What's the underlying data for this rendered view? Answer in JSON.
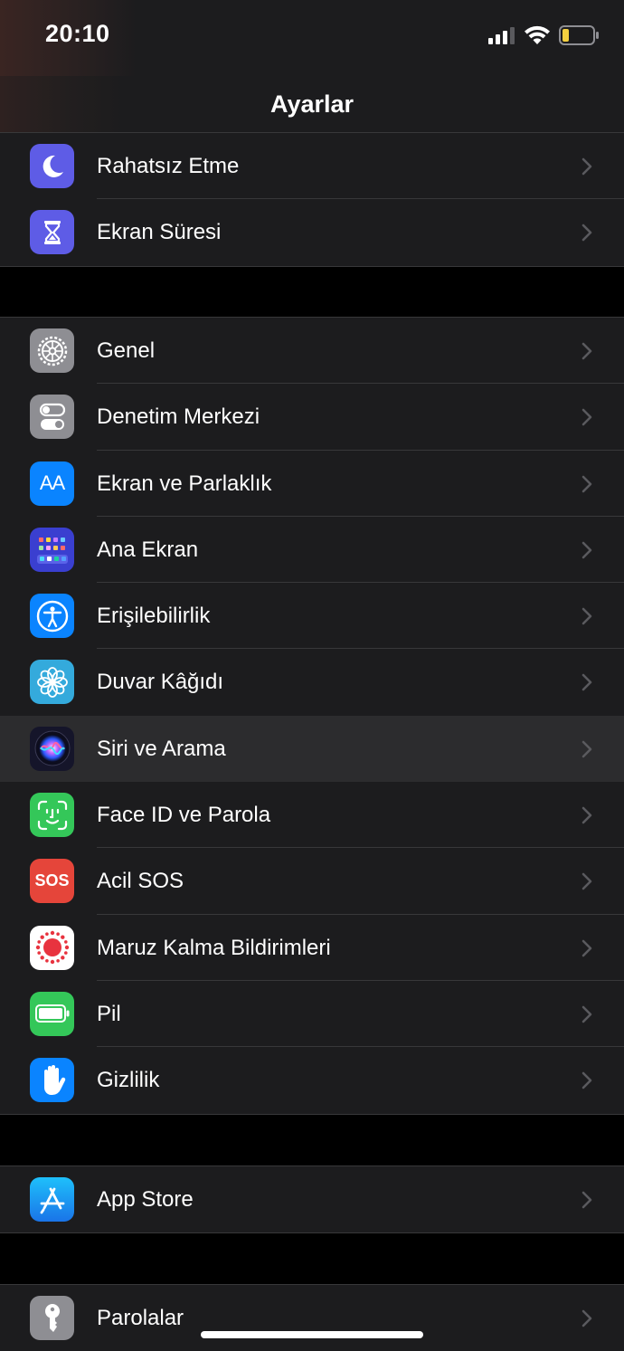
{
  "status_bar": {
    "time": "20:10",
    "icons": [
      "cellular-signal-icon",
      "wifi-icon",
      "battery-low-icon"
    ],
    "battery_color": "#f4d03f"
  },
  "navbar": {
    "title": "Ayarlar"
  },
  "groups": [
    {
      "items": [
        {
          "label": "Rahatsız Etme",
          "icon": "moon-icon",
          "color": "#5e5ce6"
        },
        {
          "label": "Ekran Süresi",
          "icon": "hourglass-icon",
          "color": "#5e5ce6"
        }
      ]
    },
    {
      "items": [
        {
          "label": "Genel",
          "icon": "gear-icon",
          "color": "#8e8e93"
        },
        {
          "label": "Denetim Merkezi",
          "icon": "toggles-icon",
          "color": "#8e8e93"
        },
        {
          "label": "Ekran ve Parlaklık",
          "icon": "text-size-icon",
          "icon_text": "AA",
          "color": "#0a84ff"
        },
        {
          "label": "Ana Ekran",
          "icon": "home-screen-grid-icon",
          "color": "#3a3fd0"
        },
        {
          "label": "Erişilebilirlik",
          "icon": "accessibility-icon",
          "color": "#0a84ff"
        },
        {
          "label": "Duvar Kâğıdı",
          "icon": "flower-icon",
          "color": "#34aadc"
        },
        {
          "label": "Siri ve Arama",
          "icon": "siri-icon",
          "color": "#1a1a2e",
          "highlighted": true
        },
        {
          "label": "Face ID ve Parola",
          "icon": "face-id-icon",
          "color": "#34c759"
        },
        {
          "label": "Acil SOS",
          "icon": "sos-icon",
          "icon_text": "SOS",
          "color": "#e5453a"
        },
        {
          "label": "Maruz Kalma Bildirimleri",
          "icon": "exposure-notification-icon",
          "color": "#ffffff"
        },
        {
          "label": "Pil",
          "icon": "battery-icon",
          "color": "#34c759"
        },
        {
          "label": "Gizlilik",
          "icon": "hand-icon",
          "color": "#0a84ff"
        }
      ]
    },
    {
      "items": [
        {
          "label": "App Store",
          "icon": "app-store-icon",
          "color": "#1c8cf5"
        }
      ]
    },
    {
      "items": [
        {
          "label": "Parolalar",
          "icon": "key-icon",
          "color": "#8e8e93"
        }
      ]
    }
  ]
}
